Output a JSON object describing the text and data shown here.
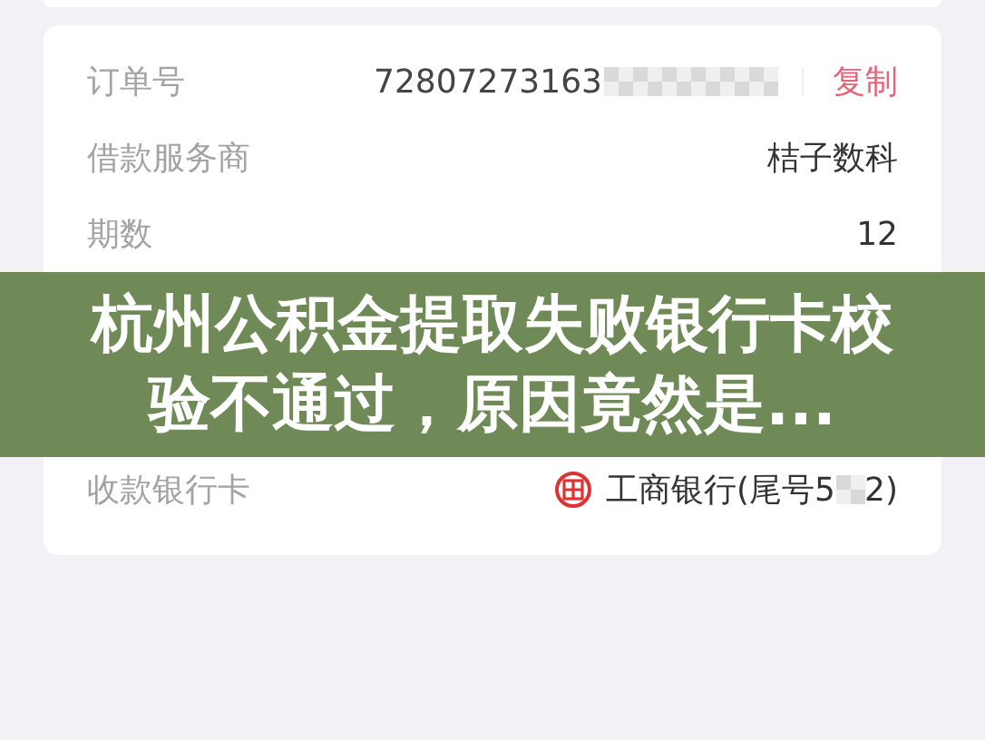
{
  "order_rows": [
    {
      "kind": "copy",
      "label": "订单号",
      "value": "72807273163",
      "action": "复制"
    },
    {
      "kind": "plain",
      "label": "借款服务商",
      "value": "桔子数科"
    },
    {
      "kind": "plain",
      "label": "期数",
      "value": "12"
    }
  ],
  "headline": "杭州公积金提取失败银行卡校验不通过，原因竟然是...",
  "bank_row": {
    "label": "收款银行卡",
    "value_start": "工商银行(尾号5",
    "value_end": "2)"
  }
}
